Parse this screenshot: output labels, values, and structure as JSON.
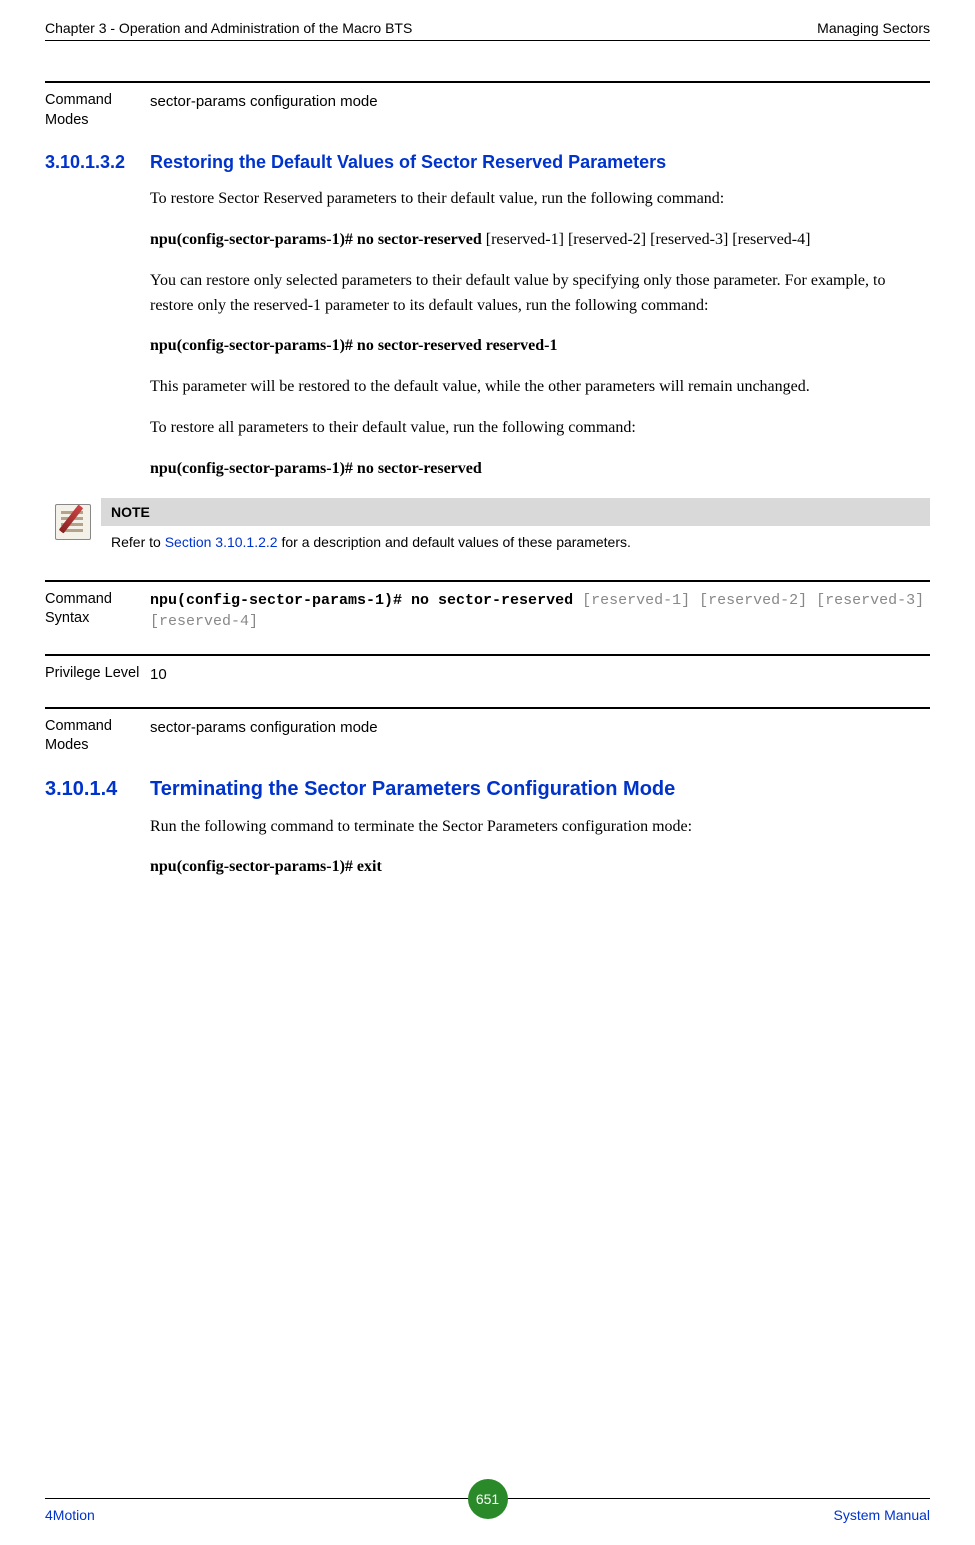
{
  "header": {
    "left": "Chapter 3 - Operation and Administration of the Macro BTS",
    "right": "Managing Sectors"
  },
  "block1": {
    "label": "Command Modes",
    "value": "sector-params configuration mode"
  },
  "sec1": {
    "num": "3.10.1.3.2",
    "title": "Restoring the Default Values of Sector Reserved Parameters",
    "p1": "To restore Sector Reserved parameters to their default value, run the following command:",
    "cmd1_bold": "npu(config-sector-params-1)# no sector-reserved",
    "cmd1_rest": " [reserved-1] [reserved-2] [reserved-3] [reserved-4]",
    "p2": "You can restore only selected parameters to their default value by specifying only those parameter. For example, to restore only the reserved-1 parameter to its default values, run the following command:",
    "cmd2": "npu(config-sector-params-1)# no sector-reserved reserved-1",
    "p3": "This parameter will be restored to the default value, while the other parameters will remain unchanged.",
    "p4": "To restore all parameters to their default value, run the following command:",
    "cmd3": "npu(config-sector-params-1)# no sector-reserved"
  },
  "note": {
    "heading": "NOTE",
    "pre": "Refer to ",
    "link": "Section 3.10.1.2.2",
    "post": " for a description and default values of these parameters."
  },
  "block2": {
    "label": "Command Syntax",
    "bold": "npu(config-sector-params-1)# no sector-reserved",
    "gray": " [reserved-1] [reserved-2] [reserved-3] [reserved-4]"
  },
  "block3": {
    "label": "Privilege Level",
    "value": "10"
  },
  "block4": {
    "label": "Command Modes",
    "value": "sector-params configuration mode"
  },
  "sec2": {
    "num": "3.10.1.4",
    "title": "Terminating the Sector Parameters Configuration Mode",
    "p1": "Run the following command to terminate the Sector Parameters configuration mode:",
    "cmd1": "npu(config-sector-params-1)# exit"
  },
  "footer": {
    "left": "4Motion",
    "page": "651",
    "right": "System Manual"
  }
}
